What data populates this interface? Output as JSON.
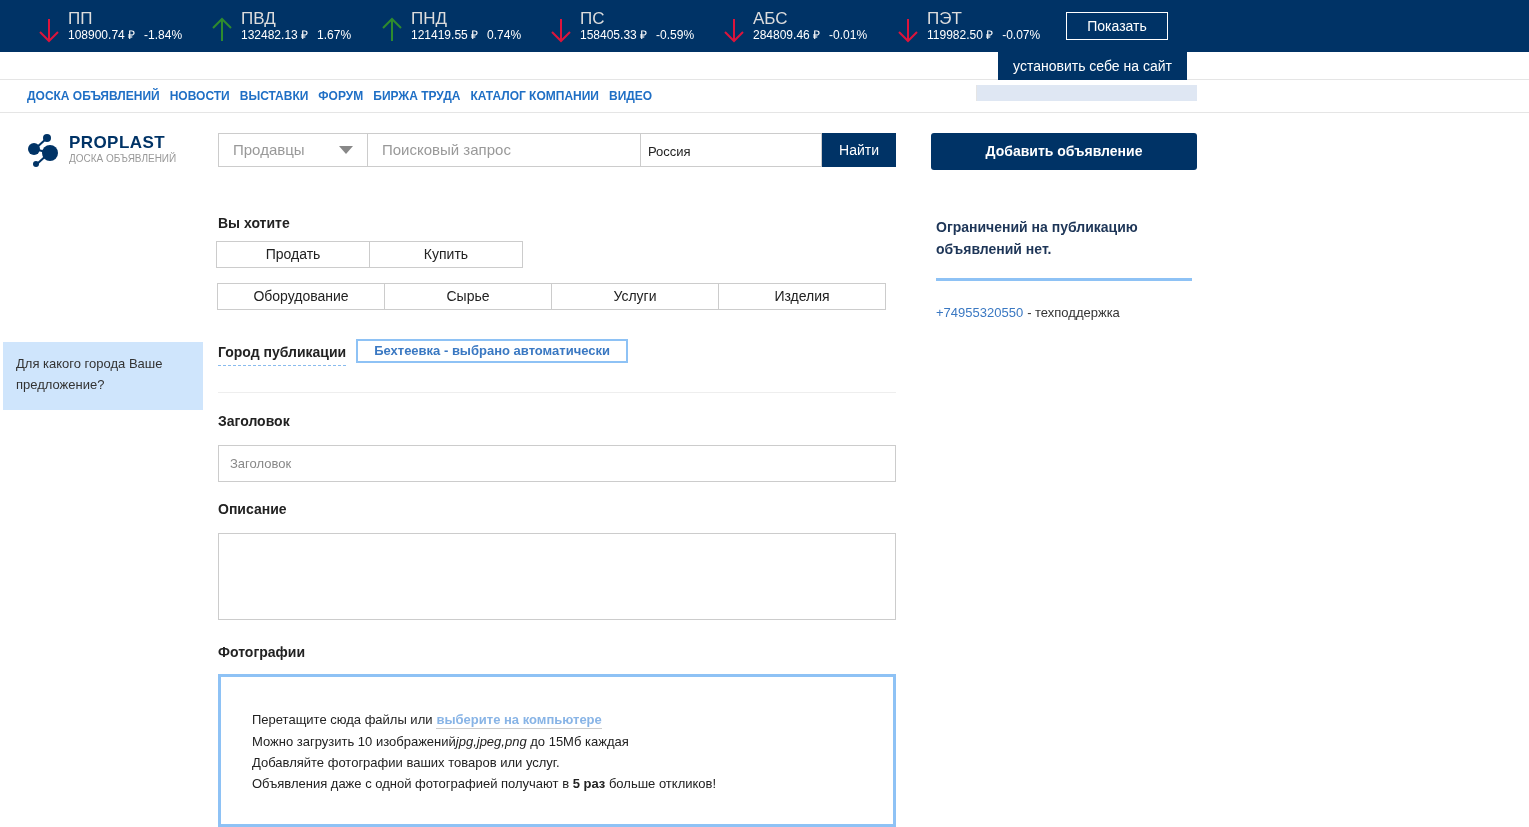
{
  "ticker": [
    {
      "name": "ПП",
      "price": "108900.74 ₽",
      "change": "-1.84%",
      "kind": "down"
    },
    {
      "name": "ПВД",
      "price": "132482.13 ₽",
      "change": "1.67%",
      "kind": "up"
    },
    {
      "name": "ПНД",
      "price": "121419.55 ₽",
      "change": "0.74%",
      "kind": "up"
    },
    {
      "name": "ПС",
      "price": "158405.33 ₽",
      "change": "-0.59%",
      "kind": "down"
    },
    {
      "name": "АБС",
      "price": "284809.46 ₽",
      "change": "-0.01%",
      "kind": "down"
    },
    {
      "name": "ПЭТ",
      "price": "119982.50 ₽",
      "change": "-0.07%",
      "kind": "down"
    }
  ],
  "ticker_button": "Показать",
  "install_tab": "установить себе на сайт",
  "nav": [
    "ДОСКА ОБЪЯВЛЕНИЙ",
    "НОВОСТИ",
    "ВЫСТАВКИ",
    "ФОРУМ",
    "БИРЖА ТРУДА",
    "КАТАЛОГ КОМПАНИИ",
    "ВИДЕО"
  ],
  "logo": {
    "name": "PROPLAST",
    "subtitle": "ДОСКА ОБЪЯВЛЕНИЙ"
  },
  "search": {
    "category": "Продавцы",
    "placeholder": "Поисковый запрос",
    "region": "Россия",
    "button": "Найти"
  },
  "add_button": "Добавить объявление",
  "form": {
    "want_label": "Вы хотите",
    "deal_types": [
      {
        "label": "Продать",
        "selected": false
      },
      {
        "label": "Купить",
        "selected": false
      }
    ],
    "categories": [
      {
        "label": "Оборудование",
        "selected": false
      },
      {
        "label": "Сырье",
        "selected": false
      },
      {
        "label": "Услуги",
        "selected": false
      },
      {
        "label": "Изделия",
        "selected": false
      }
    ],
    "city_hint": "Для какого города Ваше предложение?",
    "city_label": "Город публикации",
    "city_value": "Бехтеевка - выбрано автоматически",
    "title_label": "Заголовок",
    "title_placeholder": "Заголовок",
    "description_label": "Описание",
    "photos_label": "Фотографии",
    "photos": {
      "drop_text": "Перетащите сюда файлы или",
      "pick_link": "выберите на компьютере",
      "formats_line": {
        "before": "Можно загрузить 10 изображений",
        "formats": "jpg,jpeg,png",
        "after": " до 15Мб каждая"
      },
      "lines": [
        "Добавляйте фотографии ваших товаров или услуг.",
        "Объявления даже с одной фотографией получают в **5 раз** больше откликов!"
      ]
    }
  },
  "sidebar": {
    "notice": "Ограничений на публикацию объявлений нет.",
    "phone": "+74955320550",
    "phone_note": "- техподдержка"
  }
}
